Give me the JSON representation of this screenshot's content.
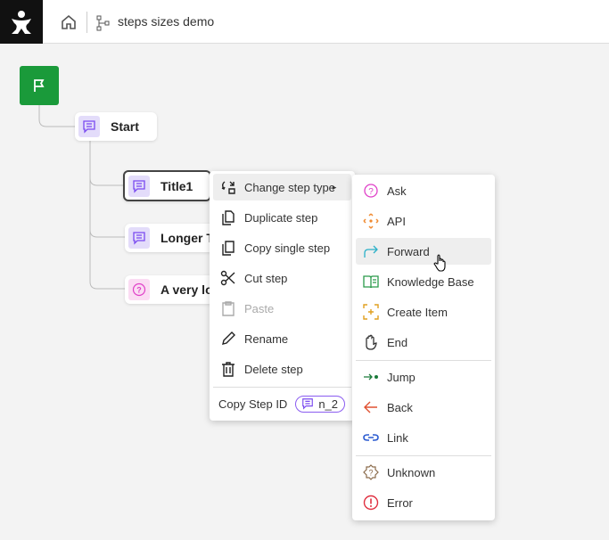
{
  "header": {
    "title": "steps sizes demo"
  },
  "nodes": [
    {
      "label": "Start",
      "icon": "message-icon"
    },
    {
      "label": "Title1",
      "icon": "message-icon",
      "selected": true
    },
    {
      "label": "Longer T",
      "icon": "message-icon"
    },
    {
      "label": "A very lo",
      "icon": "question-icon"
    }
  ],
  "context_menu": {
    "items": [
      {
        "label": "Change step type",
        "icon": "change-type-icon"
      },
      {
        "label": "Duplicate step",
        "icon": "duplicate-icon"
      },
      {
        "label": "Copy single step",
        "icon": "copy-icon"
      },
      {
        "label": "Cut step",
        "icon": "scissors-icon"
      },
      {
        "label": "Paste",
        "icon": "clipboard-icon",
        "disabled": true
      },
      {
        "label": "Rename",
        "icon": "pencil-icon"
      },
      {
        "label": "Delete step",
        "icon": "trash-icon"
      }
    ],
    "copy_id_label": "Copy Step ID",
    "step_id": "n_2"
  },
  "submenu": {
    "items": [
      {
        "label": "Ask",
        "icon": "question-icon",
        "color": "#e040c8"
      },
      {
        "label": "API",
        "icon": "api-icon",
        "color": "#f08a30"
      },
      {
        "label": "Forward",
        "icon": "forward-arrow-icon",
        "color": "#2ab0c8"
      },
      {
        "label": "Knowledge Base",
        "icon": "book-icon",
        "color": "#2a9a4a"
      },
      {
        "label": "Create Item",
        "icon": "create-item-icon",
        "color": "#e0a020"
      },
      {
        "label": "End",
        "icon": "hand-icon",
        "color": "#333333"
      },
      {
        "label": "Jump",
        "icon": "jump-icon",
        "color": "#1a7a3a"
      },
      {
        "label": "Back",
        "icon": "back-arrow-icon",
        "color": "#e05030"
      },
      {
        "label": "Link",
        "icon": "link-icon",
        "color": "#2a5ad0"
      },
      {
        "label": "Unknown",
        "icon": "unknown-icon",
        "color": "#8a6a4a"
      },
      {
        "label": "Error",
        "icon": "error-icon",
        "color": "#e03040"
      }
    ]
  }
}
